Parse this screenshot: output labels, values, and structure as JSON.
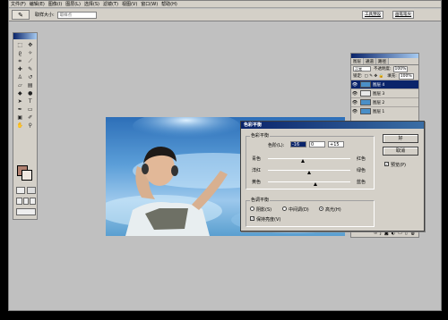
{
  "menu": [
    "文件(F)",
    "编辑(E)",
    "图像(I)",
    "图层(L)",
    "选择(S)",
    "滤镜(T)",
    "视图(V)",
    "窗口(W)",
    "帮助(H)"
  ],
  "options": {
    "label": "取样大小:",
    "value": "取样点"
  },
  "workspace_tabs": [
    "工具预设",
    "画笔笔尖"
  ],
  "layers_panel": {
    "tabs": [
      "图层",
      "通道",
      "路径"
    ],
    "blend_mode": "正常",
    "opacity_label": "不透明度:",
    "opacity_value": "100%",
    "lock_label": "锁定:",
    "fill_label": "填充:",
    "fill_value": "100%",
    "layers": [
      {
        "name": "图层 4",
        "selected": true
      },
      {
        "name": "图层 3",
        "selected": false
      },
      {
        "name": "图层 2",
        "selected": false
      },
      {
        "name": "图层 1",
        "selected": false
      }
    ]
  },
  "dialog": {
    "title": "色彩平衡",
    "group_balance": "色彩平衡",
    "levels_label": "色阶(L):",
    "levels": [
      "-16",
      "0",
      "+15"
    ],
    "sliders": [
      {
        "left": "青色",
        "right": "红色",
        "value": -16
      },
      {
        "left": "洋红",
        "right": "绿色",
        "value": 0
      },
      {
        "left": "黄色",
        "right": "蓝色",
        "value": 15
      }
    ],
    "group_tone": "色调平衡",
    "tones": [
      "阴影(S)",
      "中间调(D)",
      "高光(H)"
    ],
    "tone_selected": "高光(H)",
    "preserve_label": "保持亮度(V)",
    "preserve_checked": true,
    "ok_label": "好",
    "cancel_label": "取消",
    "preview_label": "预览(P)",
    "preview_checked": true
  },
  "colors": {
    "accent": "#0a246a",
    "foreground_swatch": "#b08070",
    "background_swatch": "#f0e8e0"
  }
}
